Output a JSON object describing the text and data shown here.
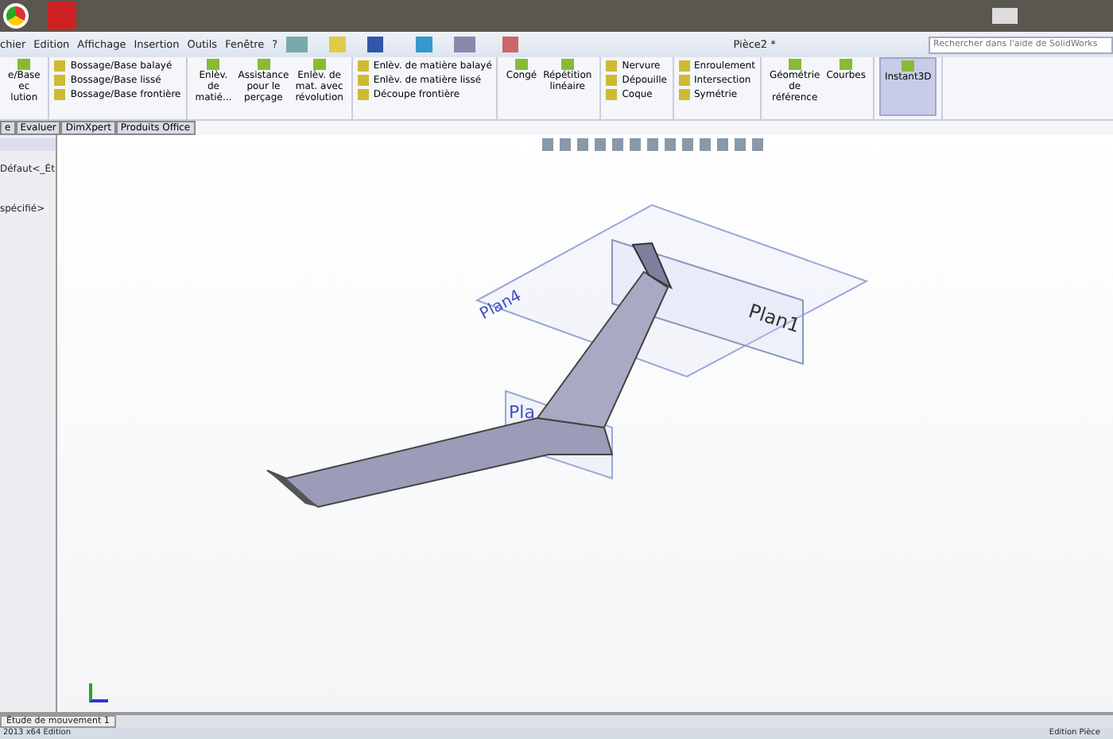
{
  "window": {
    "title": "Pièce2 *"
  },
  "menu": [
    "chier",
    "Edition",
    "Affichage",
    "Insertion",
    "Outils",
    "Fenêtre",
    "?"
  ],
  "search": {
    "placeholder": "Rechercher dans l'aide de SolidWorks"
  },
  "ribbon": [
    {
      "kind": "big",
      "items": [
        {
          "label": "e/Base\nec\nlution",
          "selected": false
        }
      ]
    },
    {
      "kind": "list",
      "items": [
        {
          "label": "Bossage/Base balayé"
        },
        {
          "label": "Bossage/Base lissé"
        },
        {
          "label": "Bossage/Base frontière"
        }
      ]
    },
    {
      "kind": "big",
      "items": [
        {
          "label": "Enlèv.\nde\nmatié...",
          "selected": false
        },
        {
          "label": "Assistance\npour le\nperçage",
          "selected": false
        },
        {
          "label": "Enlèv. de\nmat. avec\nrévolution",
          "selected": false
        }
      ]
    },
    {
      "kind": "list",
      "items": [
        {
          "label": "Enlèv. de matière balayé"
        },
        {
          "label": "Enlèv. de matière lissé"
        },
        {
          "label": "Découpe frontière"
        }
      ]
    },
    {
      "kind": "big",
      "items": [
        {
          "label": "Congé",
          "selected": false
        },
        {
          "label": "Répétition\nlinéaire",
          "selected": false
        }
      ]
    },
    {
      "kind": "list",
      "items": [
        {
          "label": "Nervure"
        },
        {
          "label": "Dépouille"
        },
        {
          "label": "Coque"
        }
      ]
    },
    {
      "kind": "list",
      "items": [
        {
          "label": "Enroulement"
        },
        {
          "label": "Intersection"
        },
        {
          "label": "Symétrie"
        }
      ]
    },
    {
      "kind": "big",
      "items": [
        {
          "label": "Géométrie\nde\nréférence",
          "selected": false
        },
        {
          "label": "Courbes",
          "selected": false
        }
      ]
    },
    {
      "kind": "big",
      "items": [
        {
          "label": "Instant3D",
          "selected": true
        }
      ]
    }
  ],
  "tabs": [
    {
      "label": "e",
      "selected": false
    },
    {
      "label": "Evaluer",
      "selected": false
    },
    {
      "label": "DimXpert",
      "selected": false
    },
    {
      "label": "Produits Office",
      "selected": false
    }
  ],
  "tree": {
    "items": [
      "Défaut<_Ét",
      "spécifié>"
    ]
  },
  "canvas": {
    "planes": [
      {
        "label": "Plan1"
      },
      {
        "label": "Plan4"
      },
      {
        "label": "Pla"
      }
    ]
  },
  "bottom_tab": "Étude de mouvement 1",
  "status_bar": {
    "left": "2013 x64 Edition",
    "right": "Edition Pièce"
  }
}
